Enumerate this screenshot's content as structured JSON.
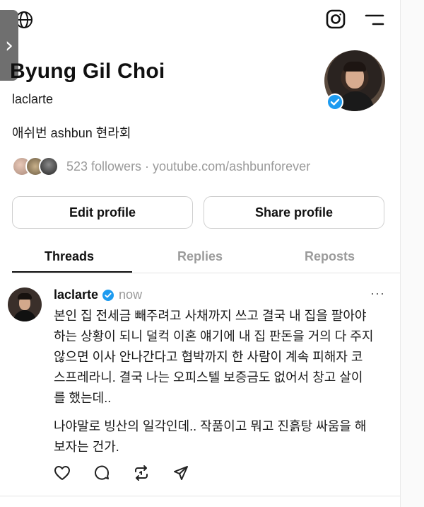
{
  "header": {
    "globe_icon": "globe-icon",
    "instagram_icon": "instagram-icon",
    "menu_icon": "menu-icon",
    "side_tab_glyph": "›"
  },
  "profile": {
    "name": "Byung Gil Choi",
    "handle": "laclarte",
    "bio": "애쉬번 ashbun 현라회",
    "followers_text": "523 followers · youtube.com/ashbunforever",
    "verified": true
  },
  "buttons": {
    "edit": "Edit profile",
    "share": "Share profile"
  },
  "tabs": [
    {
      "label": "Threads",
      "active": true
    },
    {
      "label": "Replies",
      "active": false
    },
    {
      "label": "Reposts",
      "active": false
    }
  ],
  "post": {
    "user": "laclarte",
    "time": "now",
    "more": "···",
    "lines_p1": [
      "본인 집 전세금 빼주려고 사채까지 쓰고 결국 내 집을 팔아야",
      "하는 상황이 되니 덜컥 이혼 얘기에 내 집 판돈을 거의 다 주지",
      "않으면 이사 안나간다고 협박까지 한 사람이 계속 피해자 코",
      "스프레라니. 결국 나는 오피스텔 보증금도 없어서 창고 살이",
      "를 했는데.."
    ],
    "lines_p2": [
      "나야말로 빙산의 일각인데.. 작품이고 뭐고 진흙탕 싸움을 해",
      "보자는 건가."
    ],
    "actions": [
      "heart-icon",
      "comment-icon",
      "repost-icon",
      "share-icon"
    ]
  },
  "colors": {
    "text": "#101010",
    "muted": "#9a9a9a",
    "verified": "#1d9bf0",
    "border": "#cfcfcf"
  }
}
